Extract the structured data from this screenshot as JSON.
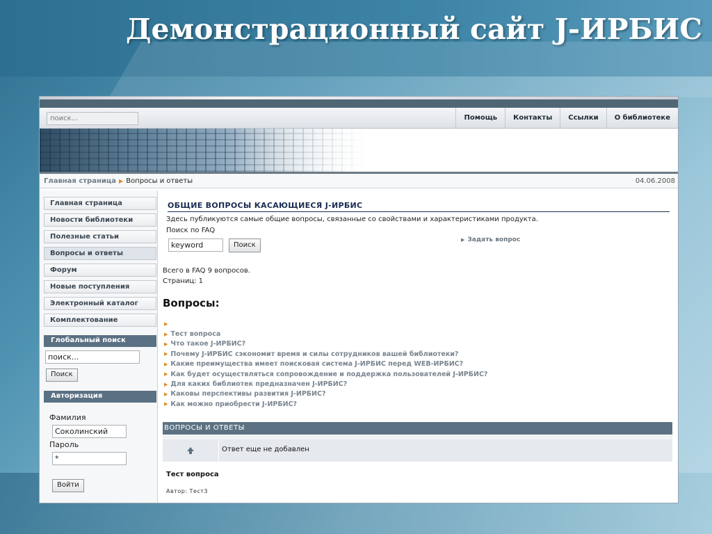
{
  "slide": {
    "title": "Демонстрационный сайт J-ИРБИС"
  },
  "header": {
    "search_placeholder": "поиск...",
    "nav": [
      "Помощь",
      "Контакты",
      "Ссылки",
      "О библиотеке"
    ]
  },
  "breadcrumb": {
    "home": "Главная страница",
    "current": "Вопросы и ответы",
    "date": "04.06.2008"
  },
  "sidebar": {
    "items": [
      "Главная страница",
      "Новости библиотеки",
      "Полезные статьи",
      "Вопросы и ответы",
      "Форум",
      "Новые поступления",
      "Электронный каталог",
      "Комплектование"
    ],
    "active_index": 3,
    "global_search": {
      "title": "Глобальный поиск",
      "value": "поиск...",
      "button": "Поиск"
    },
    "auth": {
      "title": "Авторизация",
      "surname_label": "Фамилия",
      "surname_value": "Соколинский",
      "password_label": "Пароль",
      "password_value": "*",
      "login_button": "Войти"
    }
  },
  "main": {
    "section_title": "ОБЩИЕ ВОПРОСЫ КАСАЮЩИЕСЯ J-ИРБИС",
    "intro": "Здесь публикуются самые общие вопросы, связанные со свойствами и характеристиками продукта.",
    "faq_search_label": "Поиск по FAQ",
    "faq_search_value": "keyword",
    "faq_search_button": "Поиск",
    "ask_link": "Задать вопрос",
    "total_text": "Всего в FAQ 9 вопросов.",
    "pages_text": "Страниц: 1",
    "questions_title": "Вопросы:",
    "questions": [
      "",
      "Тест вопроса",
      "Что такое J-ИРБИС?",
      "Почему J-ИРБИС сэкономит время и силы сотрудников вашей библиотеки?",
      "Какие преимущества имеет поисковая система J-ИРБИС перед WEB-ИРБИС?",
      "Как будет осуществляться сопровождение и поддержка пользователей J-ИРБИС?",
      "Для каких библиотек предназначен J-ИРБИС?",
      "Каковы перспективы развития J-ИРБИС?",
      "Как можно приобрести J-ИРБИС?"
    ],
    "qa_header": "ВОПРОСЫ И ОТВЕТЫ",
    "qa_answer": "Ответ еще не добавлен",
    "question_heading": "Тест вопроса",
    "author": "Автор: Тест3"
  }
}
